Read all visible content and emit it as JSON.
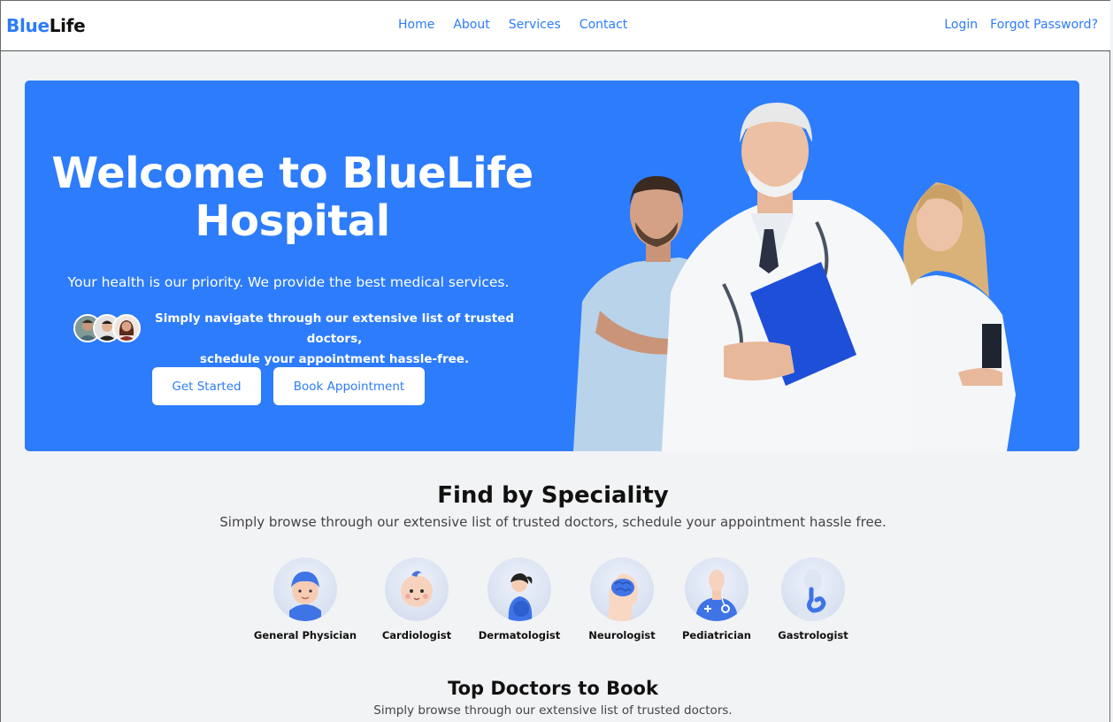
{
  "nav": {
    "logo_part1": "Blue",
    "logo_part2": "Life",
    "links": [
      "Home",
      "About",
      "Services",
      "Contact"
    ],
    "login": "Login",
    "forgot": "Forgot Password?"
  },
  "hero": {
    "title_line1": "Welcome to BlueLife",
    "title_line2": "Hospital",
    "subtitle": "Your health is our priority. We provide the best medical services.",
    "note_line1": "Simply navigate through our extensive list of trusted doctors,",
    "note_line2": "schedule your appointment hassle-free.",
    "btn_start": "Get Started",
    "btn_book": "Book Appointment"
  },
  "speciality": {
    "title": "Find by Speciality",
    "subtitle": "Simply browse through our extensive list of trusted doctors, schedule your appointment hassle free.",
    "items": [
      "General Physician",
      "Cardiologist",
      "Dermatologist",
      "Neurologist",
      "Pediatrician",
      "Gastrologist"
    ]
  },
  "top_doctors": {
    "title": "Top Doctors to Book",
    "subtitle": "Simply browse through our extensive list of trusted doctors."
  },
  "colors": {
    "accent": "#2d7cf6",
    "hero_bg": "#2d7cfb",
    "page_bg": "#f2f3f5"
  }
}
